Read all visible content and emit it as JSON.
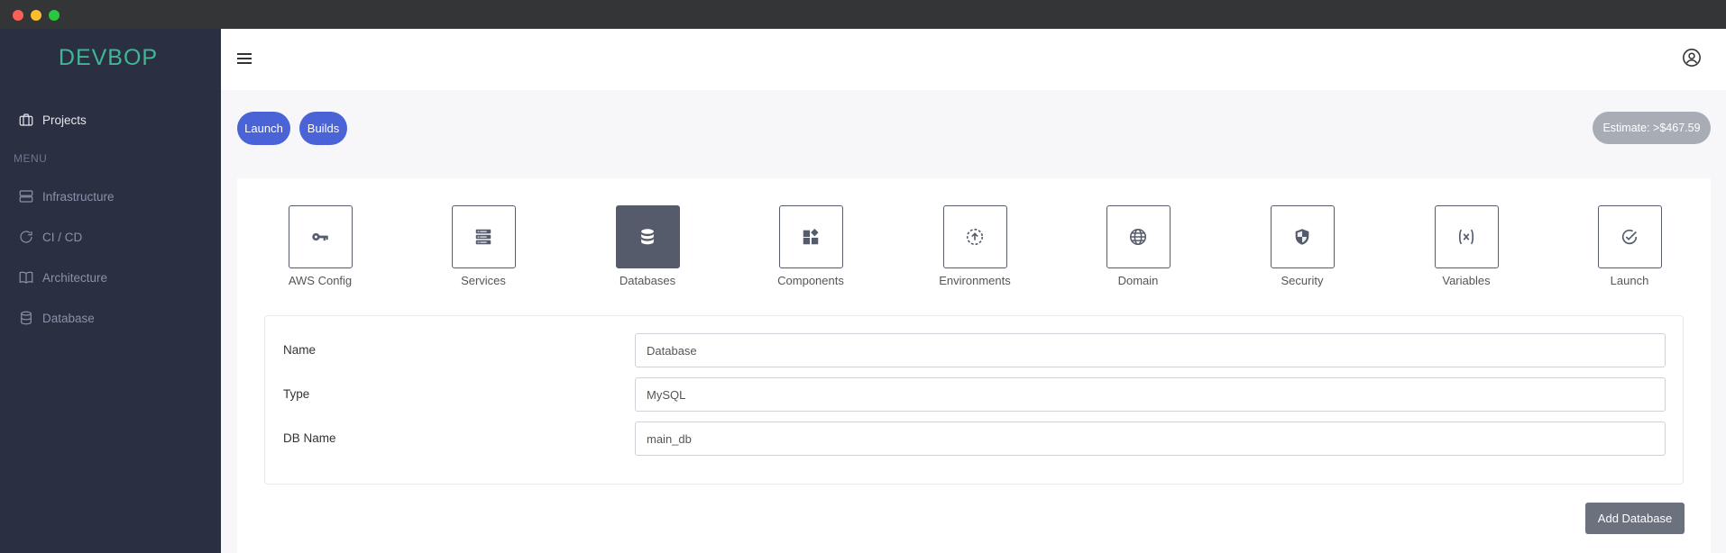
{
  "app": {
    "brand": "DEVBOP"
  },
  "sidebar": {
    "projects_label": "Projects",
    "menu_heading": "MENU",
    "items": [
      {
        "label": "Infrastructure",
        "icon": "server-icon"
      },
      {
        "label": "CI / CD",
        "icon": "refresh-icon"
      },
      {
        "label": "Architecture",
        "icon": "book-icon"
      },
      {
        "label": "Database",
        "icon": "database-icon"
      }
    ]
  },
  "toolbar": {
    "launch_label": "Launch",
    "builds_label": "Builds",
    "estimate": "Estimate: >$467.59"
  },
  "steps": [
    {
      "label": "AWS Config",
      "icon": "key-icon",
      "active": false
    },
    {
      "label": "Services",
      "icon": "server-stack-icon",
      "active": false
    },
    {
      "label": "Databases",
      "icon": "database-icon",
      "active": true
    },
    {
      "label": "Components",
      "icon": "components-icon",
      "active": false
    },
    {
      "label": "Environments",
      "icon": "upload-circle-icon",
      "active": false
    },
    {
      "label": "Domain",
      "icon": "globe-icon",
      "active": false
    },
    {
      "label": "Security",
      "icon": "shield-icon",
      "active": false
    },
    {
      "label": "Variables",
      "icon": "variable-icon",
      "active": false
    },
    {
      "label": "Launch",
      "icon": "check-circle-icon",
      "active": false
    }
  ],
  "form": {
    "fields": [
      {
        "label": "Name",
        "value": "Database"
      },
      {
        "label": "Type",
        "value": "MySQL"
      },
      {
        "label": "DB Name",
        "value": "main_db"
      }
    ],
    "add_button_label": "Add Database"
  },
  "colors": {
    "brand": "#3fb795",
    "sidebar_bg": "#2a2f42",
    "primary": "#4a63d6",
    "active_step": "#555b6b"
  }
}
